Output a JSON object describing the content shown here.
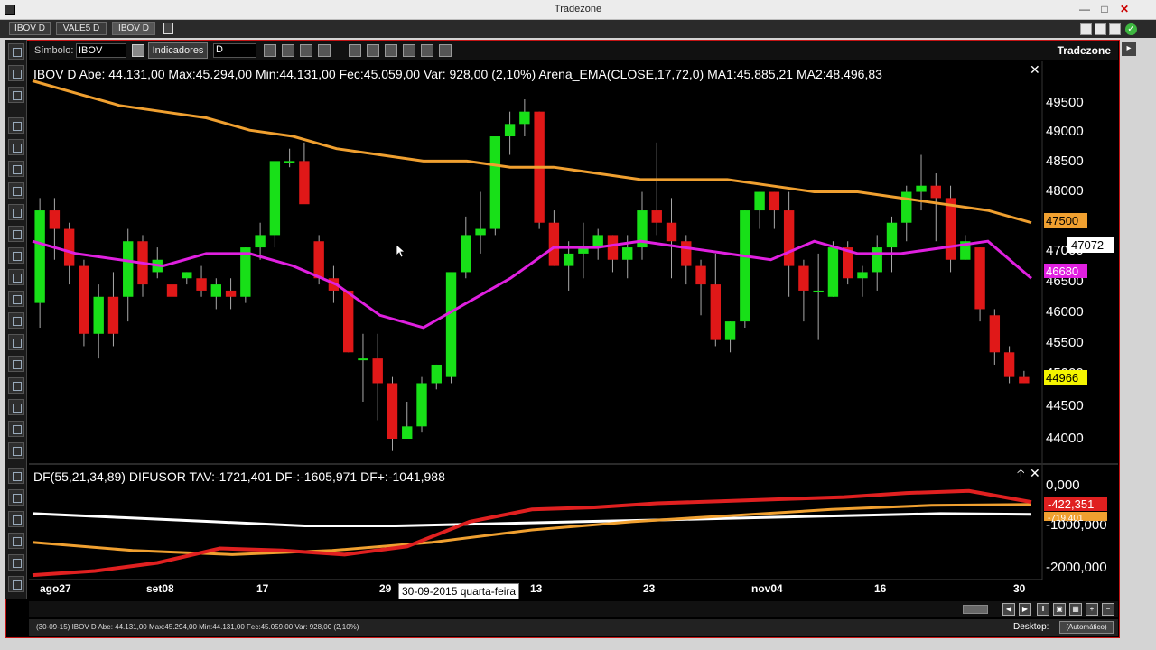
{
  "window": {
    "title": "Tradezone"
  },
  "tabs": [
    {
      "label": "IBOV D",
      "active": false
    },
    {
      "label": "VALE5 D",
      "active": false
    },
    {
      "label": "IBOV D",
      "active": true
    }
  ],
  "toolbar": {
    "symbol_label": "Símbolo:",
    "symbol_value": "IBOV",
    "indicators_label": "Indicadores",
    "period_value": "D",
    "brand": "Tradezone"
  },
  "price_panel": {
    "header": "IBOV D  Abe: 44.131,00   Max:45.294,00   Min:44.131,00   Fec:45.059,00   Var: 928,00 (2,10%)   Arena_EMA(CLOSE,17,72,0) MA1:45.885,21 MA2:48.496,83",
    "price_axis_labels": [
      "49500",
      "49000",
      "48500",
      "48000",
      "47500",
      "47000",
      "46500",
      "46000",
      "45500",
      "45000",
      "44500",
      "44000"
    ],
    "badges": {
      "ma_slow": "47500",
      "crosshair": "47072",
      "ma_fast": "46680",
      "last": "44966"
    }
  },
  "diffusor_panel": {
    "header": "DF(55,21,34,89) DIFUSOR TAV:-1721,401 DF-:-1605,971 DF+:-1041,988",
    "axis_labels": [
      "0,000",
      "-1000,000",
      "-2000,000"
    ],
    "badges": {
      "red": "-422,351",
      "stack": "-719,401"
    }
  },
  "date_axis": [
    "ago27",
    "set08",
    "17",
    "29",
    "13",
    "23",
    "nov04",
    "16",
    "30"
  ],
  "tooltip": "30-09-2015 quarta-feira",
  "status": {
    "text": "(30-09-15)  IBOV D   Abe: 44.131,00   Max:45.294,00   Min:44.131,00   Fec:45.059,00   Var: 928,00 (2,10%)",
    "desktop_label": "Desktop:",
    "desktop_value": "(Automático)"
  },
  "colors": {
    "up": "#18e018",
    "down": "#e01818",
    "ma_slow": "#f0a030",
    "ma_fast": "#e020e0",
    "df_red": "#e02020",
    "df_white": "#ffffff",
    "df_orange": "#f0a030",
    "border": "#c41414"
  },
  "chart_data": {
    "type": "candlestick",
    "series_description": "IBOV daily candles, approximate OHLC values",
    "price_range": [
      43700,
      49900
    ],
    "candles": [
      [
        46200,
        47900,
        45800,
        47700
      ],
      [
        47700,
        47900,
        46900,
        47400
      ],
      [
        47400,
        47500,
        46500,
        46800
      ],
      [
        46800,
        46900,
        45500,
        45700
      ],
      [
        45700,
        46500,
        45300,
        46300
      ],
      [
        46300,
        46700,
        45500,
        45700
      ],
      [
        46300,
        47400,
        45900,
        47200
      ],
      [
        47200,
        47300,
        46300,
        46500
      ],
      [
        46700,
        47100,
        46600,
        46900
      ],
      [
        46500,
        46700,
        46200,
        46300
      ],
      [
        46600,
        46700,
        46500,
        46700
      ],
      [
        46600,
        46800,
        46300,
        46400
      ],
      [
        46300,
        46600,
        46100,
        46500
      ],
      [
        46400,
        46600,
        46100,
        46300
      ],
      [
        46300,
        47100,
        46200,
        47100
      ],
      [
        47100,
        47500,
        46900,
        47300
      ],
      [
        47300,
        48400,
        47100,
        48500
      ],
      [
        48500,
        48700,
        48400,
        48500
      ],
      [
        48500,
        48800,
        47900,
        47800
      ],
      [
        47200,
        47300,
        46500,
        46600
      ],
      [
        46600,
        46800,
        46200,
        46400
      ],
      [
        46400,
        46400,
        45400,
        45400
      ],
      [
        45300,
        45700,
        44600,
        45300
      ],
      [
        45300,
        45700,
        44300,
        44900
      ],
      [
        44900,
        45000,
        43800,
        44000
      ],
      [
        44000,
        44600,
        44000,
        44200
      ],
      [
        44200,
        45000,
        44100,
        44900
      ],
      [
        44900,
        45200,
        44800,
        45200
      ],
      [
        45000,
        46500,
        44900,
        46700
      ],
      [
        46700,
        47600,
        46600,
        47300
      ],
      [
        47300,
        48000,
        47000,
        47400
      ],
      [
        47400,
        48600,
        47300,
        48900
      ],
      [
        48900,
        49300,
        48600,
        49100
      ],
      [
        49100,
        49500,
        48900,
        49300
      ],
      [
        49300,
        49300,
        47400,
        47500
      ],
      [
        47500,
        47700,
        46800,
        46800
      ],
      [
        46800,
        47200,
        46400,
        47000
      ],
      [
        47000,
        47500,
        46600,
        47100
      ],
      [
        47100,
        47400,
        46900,
        47300
      ],
      [
        47300,
        47300,
        46700,
        46900
      ],
      [
        46900,
        47300,
        46600,
        47100
      ],
      [
        47100,
        48000,
        46900,
        47700
      ],
      [
        47700,
        48800,
        47300,
        47500
      ],
      [
        47500,
        47900,
        46600,
        47200
      ],
      [
        47200,
        47300,
        46500,
        46800
      ],
      [
        46800,
        46900,
        46000,
        46500
      ],
      [
        46500,
        47000,
        45500,
        45600
      ],
      [
        45600,
        45900,
        45400,
        45900
      ],
      [
        45900,
        47700,
        45800,
        47700
      ],
      [
        47700,
        48000,
        47400,
        48000
      ],
      [
        48000,
        48000,
        47400,
        47700
      ],
      [
        47700,
        48000,
        46300,
        46800
      ],
      [
        46800,
        46900,
        45900,
        46400
      ],
      [
        46400,
        47000,
        45600,
        46400
      ],
      [
        46300,
        47200,
        46300,
        47100
      ],
      [
        47100,
        47200,
        46500,
        46600
      ],
      [
        46600,
        46800,
        46300,
        46700
      ],
      [
        46700,
        47300,
        46400,
        47100
      ],
      [
        47100,
        47600,
        46700,
        47500
      ],
      [
        47500,
        48100,
        47200,
        48000
      ],
      [
        48000,
        48600,
        47700,
        48100
      ],
      [
        48100,
        48300,
        47200,
        47900
      ],
      [
        47900,
        48100,
        46700,
        46900
      ],
      [
        46900,
        47300,
        46900,
        47200
      ],
      [
        47100,
        47100,
        45900,
        46100
      ],
      [
        46000,
        46100,
        45200,
        45400
      ],
      [
        45400,
        45500,
        44900,
        45000
      ],
      [
        45000,
        45100,
        44900,
        44900
      ]
    ],
    "ma_slow": [
      49800,
      49600,
      49400,
      49300,
      49200,
      49000,
      48900,
      48700,
      48600,
      48500,
      48500,
      48400,
      48400,
      48300,
      48200,
      48200,
      48200,
      48100,
      48000,
      48000,
      47900,
      47800,
      47700,
      47500
    ],
    "ma_fast": [
      47200,
      47000,
      46900,
      46800,
      47000,
      47000,
      46800,
      46500,
      46000,
      45800,
      46200,
      46600,
      47100,
      47100,
      47200,
      47100,
      47000,
      46900,
      47200,
      47000,
      47000,
      47100,
      47200,
      46600
    ],
    "diffusor_range": [
      -2300,
      100
    ],
    "df_red": [
      -2200,
      -2100,
      -1900,
      -1550,
      -1600,
      -1700,
      -1500,
      -900,
      -600,
      -550,
      -450,
      -400,
      -350,
      -300,
      -200,
      -150,
      -420
    ],
    "df_white": [
      -700,
      -800,
      -900,
      -1000,
      -1000,
      -950,
      -900,
      -850,
      -800,
      -750,
      -700,
      -719
    ],
    "df_orange": [
      -1400,
      -1600,
      -1700,
      -1600,
      -1400,
      -1100,
      -900,
      -750,
      -600,
      -500,
      -480
    ]
  }
}
